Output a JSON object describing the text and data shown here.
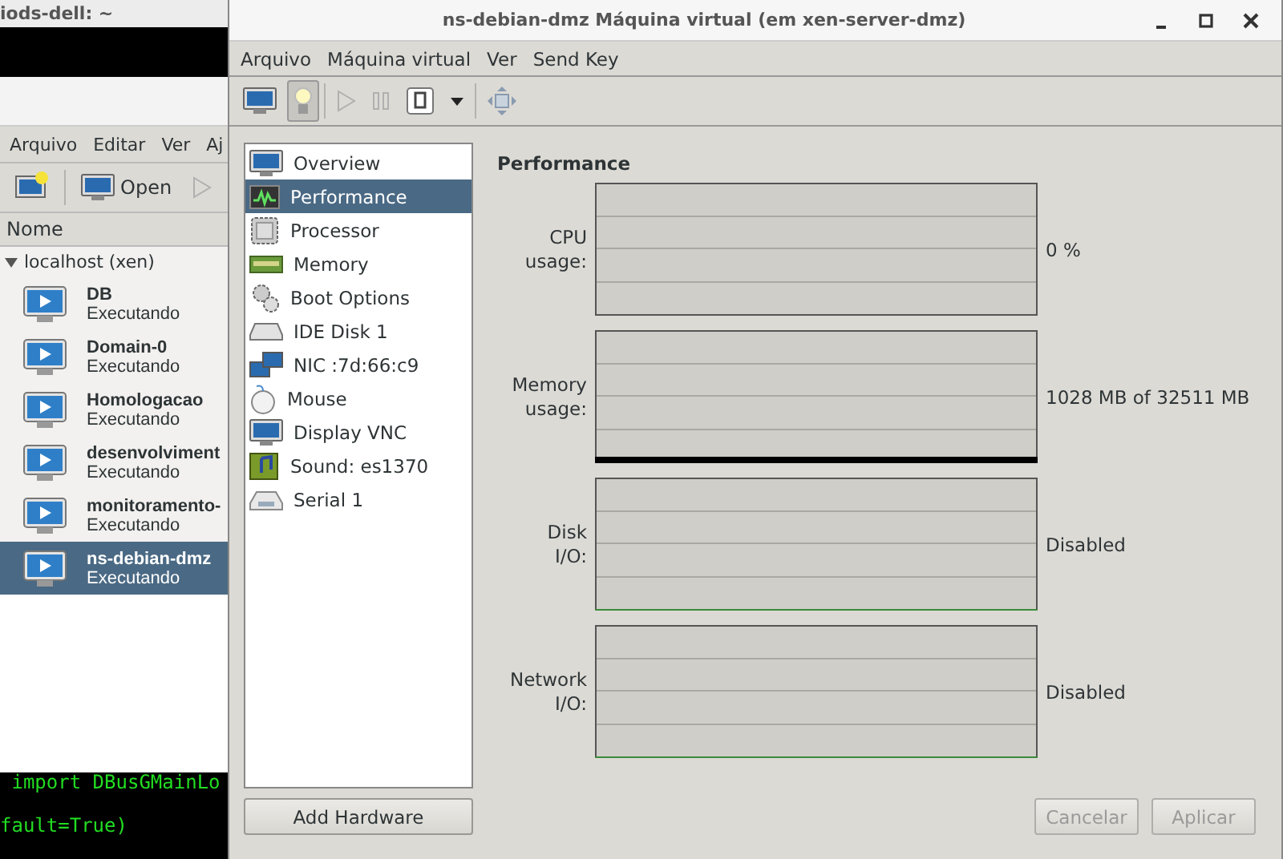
{
  "terminal": {
    "title": "iods-dell: ~",
    "lines": [
      " import DBusGMainLo",
      "fault=True)"
    ]
  },
  "manager_window": {
    "menu": [
      "Arquivo",
      "Editar",
      "Ver",
      "Aj"
    ],
    "toolbar": [
      {
        "kind": "new"
      },
      {
        "kind": "open",
        "label": "Open"
      },
      {
        "kind": "run",
        "disabled": true
      }
    ],
    "column_header": "Nome",
    "host": {
      "label": "localhost (xen)",
      "expanded": true,
      "vms": [
        {
          "name": "DB",
          "status": "Executando",
          "selected": false
        },
        {
          "name": "Domain-0",
          "status": "Executando",
          "selected": false
        },
        {
          "name": "Homologacao",
          "status": "Executando",
          "selected": false
        },
        {
          "name": "desenvolviment",
          "status": "Executando",
          "selected": false
        },
        {
          "name": "monitoramento-",
          "status": "Executando",
          "selected": false
        },
        {
          "name": "ns-debian-dmz",
          "status": "Executando",
          "selected": true
        }
      ]
    }
  },
  "vm_window": {
    "title": "ns-debian-dmz Máquina virtual (em xen-server-dmz)",
    "menu": [
      "Arquivo",
      "Máquina virtual",
      "Ver",
      "Send Key"
    ],
    "toolbar": [
      {
        "kind": "console",
        "selected": false
      },
      {
        "kind": "details",
        "selected": true
      },
      {
        "kind": "separator"
      },
      {
        "kind": "run",
        "disabled": true
      },
      {
        "kind": "pause",
        "disabled": true
      },
      {
        "kind": "shutdown"
      },
      {
        "kind": "caret"
      },
      {
        "kind": "separator"
      },
      {
        "kind": "fullscreen",
        "disabled": true
      }
    ],
    "hardware": [
      {
        "kind": "overview",
        "label": "Overview",
        "selected": false
      },
      {
        "kind": "performance",
        "label": "Performance",
        "selected": true
      },
      {
        "kind": "processor",
        "label": "Processor",
        "selected": false
      },
      {
        "kind": "memory",
        "label": "Memory",
        "selected": false
      },
      {
        "kind": "boot",
        "label": "Boot Options",
        "selected": false
      },
      {
        "kind": "disk",
        "label": "IDE Disk 1",
        "selected": false
      },
      {
        "kind": "nic",
        "label": "NIC :7d:66:c9",
        "selected": false
      },
      {
        "kind": "mouse",
        "label": "Mouse",
        "selected": false
      },
      {
        "kind": "display",
        "label": "Display VNC",
        "selected": false
      },
      {
        "kind": "sound",
        "label": "Sound: es1370",
        "selected": false
      },
      {
        "kind": "serial",
        "label": "Serial 1",
        "selected": false
      }
    ],
    "add_hardware": "Add Hardware",
    "section_title": "Performance",
    "graphs": [
      {
        "kind": "cpu",
        "label": "CPU\nusage:",
        "reading": "0 %"
      },
      {
        "kind": "memory",
        "label": "Memory\nusage:",
        "reading": "1028 MB of 32511 MB"
      },
      {
        "kind": "disk",
        "label": "Disk\nI/O:",
        "reading": "Disabled"
      },
      {
        "kind": "network",
        "label": "Network\nI/O:",
        "reading": "Disabled"
      }
    ],
    "buttons": [
      {
        "label": "Cancelar",
        "disabled": true
      },
      {
        "label": "Aplicar",
        "disabled": true
      }
    ]
  }
}
